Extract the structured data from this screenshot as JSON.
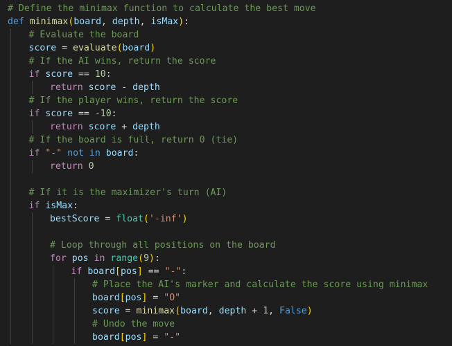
{
  "editor": {
    "language": "python",
    "theme": "dark",
    "colors": {
      "background": "#1e1e1e",
      "comment": "#6a9955",
      "keyword": "#569cd6",
      "control": "#c586c0",
      "function": "#dcdcaa",
      "variable": "#9cdcfe",
      "number": "#b5cea8",
      "string": "#ce9178",
      "operator": "#d4d4d4",
      "bracket_level1": "#ffd700",
      "bracket_level2": "#da70d6"
    },
    "lines": [
      {
        "indent": 0,
        "tokens": [
          {
            "t": "# Define the minimax function to calculate the best move",
            "c": "comment"
          }
        ]
      },
      {
        "indent": 0,
        "tokens": [
          {
            "t": "def",
            "c": "keyword"
          },
          {
            "t": " ",
            "c": "op"
          },
          {
            "t": "minimax",
            "c": "func"
          },
          {
            "t": "(",
            "c": "p1"
          },
          {
            "t": "board",
            "c": "var"
          },
          {
            "t": ", ",
            "c": "punc"
          },
          {
            "t": "depth",
            "c": "var"
          },
          {
            "t": ", ",
            "c": "punc"
          },
          {
            "t": "isMax",
            "c": "var"
          },
          {
            "t": ")",
            "c": "p1"
          },
          {
            "t": ":",
            "c": "punc"
          }
        ]
      },
      {
        "indent": 1,
        "tokens": [
          {
            "t": "# Evaluate the board",
            "c": "comment"
          }
        ]
      },
      {
        "indent": 1,
        "tokens": [
          {
            "t": "score",
            "c": "var"
          },
          {
            "t": " = ",
            "c": "op"
          },
          {
            "t": "evaluate",
            "c": "func"
          },
          {
            "t": "(",
            "c": "p1"
          },
          {
            "t": "board",
            "c": "var"
          },
          {
            "t": ")",
            "c": "p1"
          }
        ]
      },
      {
        "indent": 1,
        "tokens": [
          {
            "t": "# If the AI wins, return the score",
            "c": "comment"
          }
        ]
      },
      {
        "indent": 1,
        "tokens": [
          {
            "t": "if",
            "c": "control"
          },
          {
            "t": " ",
            "c": "op"
          },
          {
            "t": "score",
            "c": "var"
          },
          {
            "t": " == ",
            "c": "op"
          },
          {
            "t": "10",
            "c": "num"
          },
          {
            "t": ":",
            "c": "punc"
          }
        ]
      },
      {
        "indent": 2,
        "tokens": [
          {
            "t": "return",
            "c": "control"
          },
          {
            "t": " ",
            "c": "op"
          },
          {
            "t": "score",
            "c": "var"
          },
          {
            "t": " - ",
            "c": "op"
          },
          {
            "t": "depth",
            "c": "var"
          }
        ]
      },
      {
        "indent": 1,
        "tokens": [
          {
            "t": "# If the player wins, return the score",
            "c": "comment"
          }
        ]
      },
      {
        "indent": 1,
        "tokens": [
          {
            "t": "if",
            "c": "control"
          },
          {
            "t": " ",
            "c": "op"
          },
          {
            "t": "score",
            "c": "var"
          },
          {
            "t": " == ",
            "c": "op"
          },
          {
            "t": "-10",
            "c": "num"
          },
          {
            "t": ":",
            "c": "punc"
          }
        ]
      },
      {
        "indent": 2,
        "tokens": [
          {
            "t": "return",
            "c": "control"
          },
          {
            "t": " ",
            "c": "op"
          },
          {
            "t": "score",
            "c": "var"
          },
          {
            "t": " + ",
            "c": "op"
          },
          {
            "t": "depth",
            "c": "var"
          }
        ]
      },
      {
        "indent": 1,
        "tokens": [
          {
            "t": "# If the board is full, return 0 (tie)",
            "c": "comment"
          }
        ]
      },
      {
        "indent": 1,
        "tokens": [
          {
            "t": "if",
            "c": "control"
          },
          {
            "t": " ",
            "c": "op"
          },
          {
            "t": "\"-\"",
            "c": "str"
          },
          {
            "t": " ",
            "c": "op"
          },
          {
            "t": "not",
            "c": "keyword"
          },
          {
            "t": " ",
            "c": "op"
          },
          {
            "t": "in",
            "c": "keyword"
          },
          {
            "t": " ",
            "c": "op"
          },
          {
            "t": "board",
            "c": "var"
          },
          {
            "t": ":",
            "c": "punc"
          }
        ]
      },
      {
        "indent": 2,
        "tokens": [
          {
            "t": "return",
            "c": "control"
          },
          {
            "t": " ",
            "c": "op"
          },
          {
            "t": "0",
            "c": "num"
          }
        ]
      },
      {
        "indent": 1,
        "tokens": []
      },
      {
        "indent": 1,
        "tokens": [
          {
            "t": "# If it is the maximizer's turn (AI)",
            "c": "comment"
          }
        ]
      },
      {
        "indent": 1,
        "tokens": [
          {
            "t": "if",
            "c": "control"
          },
          {
            "t": " ",
            "c": "op"
          },
          {
            "t": "isMax",
            "c": "var"
          },
          {
            "t": ":",
            "c": "punc"
          }
        ]
      },
      {
        "indent": 2,
        "tokens": [
          {
            "t": "bestScore",
            "c": "var"
          },
          {
            "t": " = ",
            "c": "op"
          },
          {
            "t": "float",
            "c": "builtin"
          },
          {
            "t": "(",
            "c": "p1"
          },
          {
            "t": "'-inf'",
            "c": "str"
          },
          {
            "t": ")",
            "c": "p1"
          }
        ]
      },
      {
        "indent": 2,
        "tokens": []
      },
      {
        "indent": 2,
        "tokens": [
          {
            "t": "# Loop through all positions on the board",
            "c": "comment"
          }
        ]
      },
      {
        "indent": 2,
        "tokens": [
          {
            "t": "for",
            "c": "control"
          },
          {
            "t": " ",
            "c": "op"
          },
          {
            "t": "pos",
            "c": "var"
          },
          {
            "t": " ",
            "c": "op"
          },
          {
            "t": "in",
            "c": "control"
          },
          {
            "t": " ",
            "c": "op"
          },
          {
            "t": "range",
            "c": "builtin"
          },
          {
            "t": "(",
            "c": "p1"
          },
          {
            "t": "9",
            "c": "num"
          },
          {
            "t": ")",
            "c": "p1"
          },
          {
            "t": ":",
            "c": "punc"
          }
        ]
      },
      {
        "indent": 3,
        "tokens": [
          {
            "t": "if",
            "c": "control"
          },
          {
            "t": " ",
            "c": "op"
          },
          {
            "t": "board",
            "c": "var"
          },
          {
            "t": "[",
            "c": "p1"
          },
          {
            "t": "pos",
            "c": "var"
          },
          {
            "t": "]",
            "c": "p1"
          },
          {
            "t": " == ",
            "c": "op"
          },
          {
            "t": "\"-\"",
            "c": "str"
          },
          {
            "t": ":",
            "c": "punc"
          }
        ]
      },
      {
        "indent": 4,
        "tokens": [
          {
            "t": "# Place the AI's marker and calculate the score using minimax",
            "c": "comment"
          }
        ]
      },
      {
        "indent": 4,
        "tokens": [
          {
            "t": "board",
            "c": "var"
          },
          {
            "t": "[",
            "c": "p1"
          },
          {
            "t": "pos",
            "c": "var"
          },
          {
            "t": "]",
            "c": "p1"
          },
          {
            "t": " = ",
            "c": "op"
          },
          {
            "t": "\"O\"",
            "c": "str"
          }
        ]
      },
      {
        "indent": 4,
        "tokens": [
          {
            "t": "score",
            "c": "var"
          },
          {
            "t": " = ",
            "c": "op"
          },
          {
            "t": "minimax",
            "c": "func"
          },
          {
            "t": "(",
            "c": "p1"
          },
          {
            "t": "board",
            "c": "var"
          },
          {
            "t": ", ",
            "c": "punc"
          },
          {
            "t": "depth",
            "c": "var"
          },
          {
            "t": " + ",
            "c": "op"
          },
          {
            "t": "1",
            "c": "num"
          },
          {
            "t": ", ",
            "c": "punc"
          },
          {
            "t": "False",
            "c": "keyword"
          },
          {
            "t": ")",
            "c": "p1"
          }
        ]
      },
      {
        "indent": 4,
        "tokens": [
          {
            "t": "# Undo the move",
            "c": "comment"
          }
        ]
      },
      {
        "indent": 4,
        "tokens": [
          {
            "t": "board",
            "c": "var"
          },
          {
            "t": "[",
            "c": "p1"
          },
          {
            "t": "pos",
            "c": "var"
          },
          {
            "t": "]",
            "c": "p1"
          },
          {
            "t": " = ",
            "c": "op"
          },
          {
            "t": "\"-\"",
            "c": "str"
          }
        ]
      }
    ]
  }
}
